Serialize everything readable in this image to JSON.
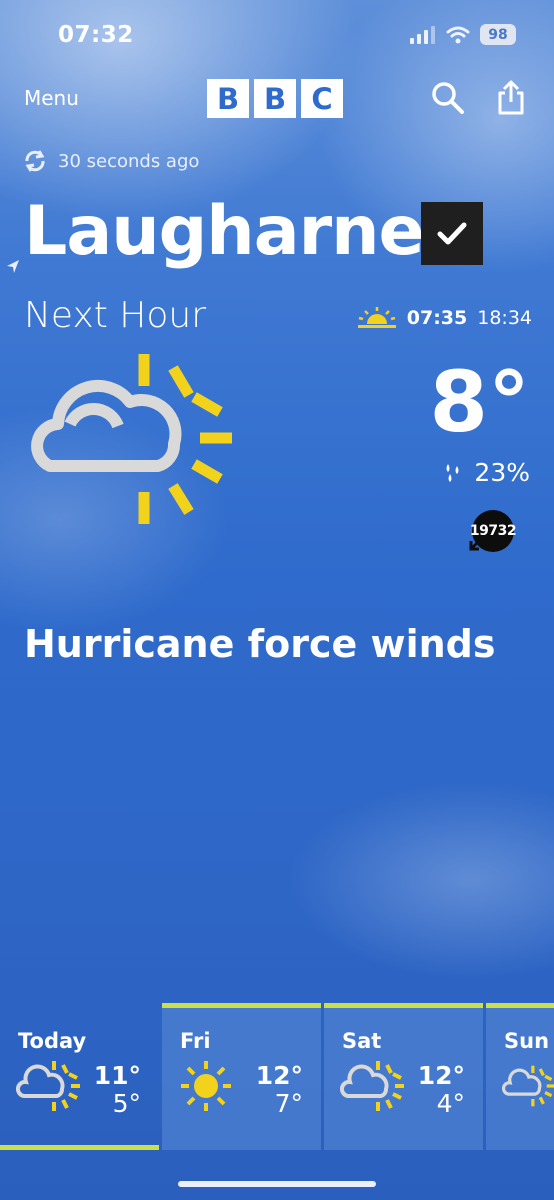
{
  "status_bar": {
    "time": "07:32",
    "battery": "98"
  },
  "header": {
    "menu_label": "Menu",
    "logo_letters": [
      "B",
      "B",
      "C"
    ]
  },
  "updated": "30 seconds ago",
  "location": "Laugharne",
  "next_hour": {
    "label": "Next Hour",
    "sunrise": "07:35",
    "sunset": "18:34",
    "temperature": "8°",
    "precipitation": "23%",
    "wind_speed": "19732",
    "summary": "Hurricane force winds",
    "icon": "sunny-intervals-icon"
  },
  "forecast": [
    {
      "day": "Today",
      "max": "11°",
      "min": "5°",
      "icon": "sunny-intervals-icon"
    },
    {
      "day": "Fri",
      "max": "12°",
      "min": "7°",
      "icon": "sunny-icon"
    },
    {
      "day": "Sat",
      "max": "12°",
      "min": "4°",
      "icon": "sunny-intervals-icon"
    },
    {
      "day": "Sun",
      "max": "",
      "min": "",
      "icon": "sunny-intervals-icon"
    }
  ],
  "colors": {
    "sun": "#f2d21a",
    "cloud": "#d9d9d9",
    "accent": "#c9e04a",
    "sky": "#2f6bcc"
  }
}
